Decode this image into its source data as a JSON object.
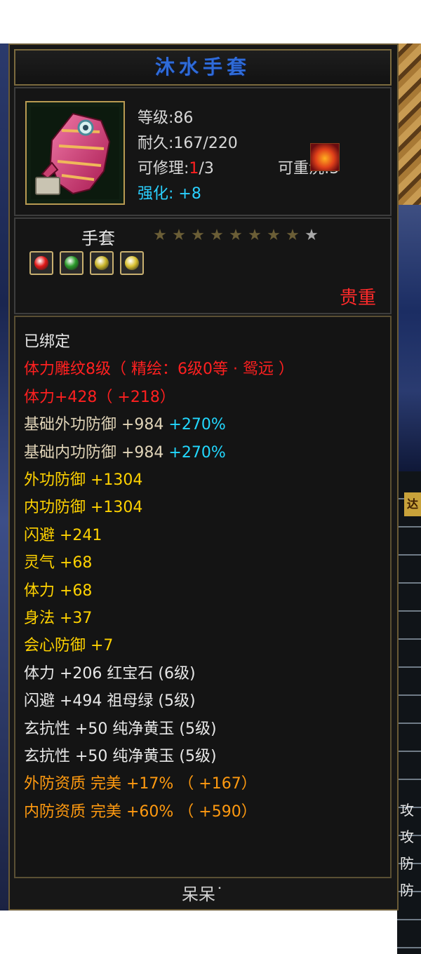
{
  "item": {
    "name": "沐水手套",
    "level": "等级:86",
    "durability": "耐久:167/220",
    "repair_prefix": "可修理:",
    "repair_current": "1",
    "repair_suffix": "/3",
    "rewash": "可重洗:3",
    "enhance": "强化: +8",
    "type": "手套",
    "rarity": "贵重",
    "stars_total": 9,
    "stars_lit": 8
  },
  "gems": [
    {
      "icon": "ruby-gem-icon",
      "color": "#e01818"
    },
    {
      "icon": "emerald-gem-icon",
      "color": "#2a9a2a"
    },
    {
      "icon": "topaz-gem-icon",
      "color": "#c8b428"
    },
    {
      "icon": "topaz-gem-icon",
      "color": "#d8c030"
    }
  ],
  "attributes": [
    {
      "text": "已绑定",
      "color": "white"
    },
    {
      "text": "体力雕纹8级（ 精绘：6级0等 · 鸳远 ）",
      "color": "red"
    },
    {
      "text": "体力+428（ +218）",
      "color": "red"
    },
    {
      "text": "基础外功防御 +984 ",
      "extra": "+270%",
      "color": "tan"
    },
    {
      "text": "基础内功防御 +984 ",
      "extra": "+270%",
      "color": "tan"
    },
    {
      "text": "外功防御 +1304",
      "color": "yellow"
    },
    {
      "text": "内功防御 +1304",
      "color": "yellow"
    },
    {
      "text": "闪避 +241",
      "color": "yellow"
    },
    {
      "text": "灵气 +68",
      "color": "yellow"
    },
    {
      "text": "体力 +68",
      "color": "yellow"
    },
    {
      "text": "身法 +37",
      "color": "yellow"
    },
    {
      "text": "会心防御 +7",
      "color": "yellow"
    },
    {
      "text": "体力 +206 红宝石 (6级)",
      "color": "white"
    },
    {
      "text": "闪避 +494 祖母绿 (5级)",
      "color": "white"
    },
    {
      "text": "玄抗性 +50 纯净黄玉 (5级)",
      "color": "white"
    },
    {
      "text": "玄抗性 +50 纯净黄玉 (5级)",
      "color": "white"
    },
    {
      "text": "外防资质   完美 +17% （ +167）",
      "color": "orange"
    },
    {
      "text": "内防资质   完美 +60% （ +590）",
      "color": "orange"
    }
  ],
  "footer": "呆呆˙",
  "background_side_chars": [
    "攻",
    "攻",
    "防",
    "防"
  ],
  "background_label": "达"
}
